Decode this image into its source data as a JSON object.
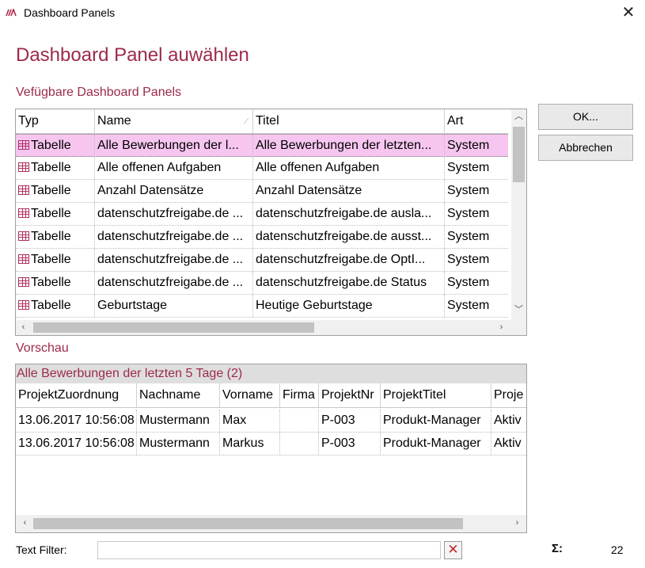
{
  "window": {
    "title": "Dashboard Panels",
    "close_glyph": "✕"
  },
  "heading": "Dashboard Panel auwählen",
  "available_section_label": "Vefügbare Dashboard Panels",
  "panels_table": {
    "columns": [
      "Typ",
      "Name",
      "Titel",
      "Art"
    ],
    "sort_indicator": "⟋",
    "rows": [
      {
        "typ": "Tabelle",
        "name": "Alle Bewerbungen der l...",
        "titel": "Alle Bewerbungen der letzten...",
        "art": "System",
        "selected": true
      },
      {
        "typ": "Tabelle",
        "name": "Alle offenen Aufgaben",
        "titel": "Alle offenen Aufgaben",
        "art": "System"
      },
      {
        "typ": "Tabelle",
        "name": "Anzahl Datensätze",
        "titel": "Anzahl Datensätze",
        "art": "System"
      },
      {
        "typ": "Tabelle",
        "name": "datenschutzfreigabe.de ...",
        "titel": "datenschutzfreigabe.de ausla...",
        "art": "System"
      },
      {
        "typ": "Tabelle",
        "name": "datenschutzfreigabe.de ...",
        "titel": "datenschutzfreigabe.de ausst...",
        "art": "System"
      },
      {
        "typ": "Tabelle",
        "name": "datenschutzfreigabe.de ...",
        "titel": "datenschutzfreigabe.de OptI...",
        "art": "System"
      },
      {
        "typ": "Tabelle",
        "name": "datenschutzfreigabe.de ...",
        "titel": "datenschutzfreigabe.de Status",
        "art": "System"
      },
      {
        "typ": "Tabelle",
        "name": "Geburtstage",
        "titel": "Heutige Geburtstage",
        "art": "System"
      }
    ]
  },
  "buttons": {
    "ok": "OK...",
    "cancel": "Abbrechen"
  },
  "preview_section_label": "Vorschau",
  "preview": {
    "title": "Alle Bewerbungen der letzten 5 Tage (2)",
    "columns": [
      "ProjektZuordnung",
      "Nachname",
      "Vorname",
      "Firma",
      "ProjektNr",
      "ProjektTitel",
      "Proje"
    ],
    "rows": [
      [
        "13.06.2017 10:56:08",
        "Mustermann",
        "Max",
        "",
        "P-003",
        "Produkt-Manager",
        "Aktiv"
      ],
      [
        "13.06.2017 10:56:08",
        "Mustermann",
        "Markus",
        "",
        "P-003",
        "Produkt-Manager",
        "Aktiv"
      ]
    ]
  },
  "footer": {
    "filter_label": "Text Filter:",
    "filter_value": "",
    "clear_glyph": "✕",
    "sigma": "Σ:",
    "count": "22"
  },
  "colors": {
    "accent": "#9c2a4a",
    "selected_row": "#f6c6f0",
    "clear_red": "#c0282b"
  }
}
